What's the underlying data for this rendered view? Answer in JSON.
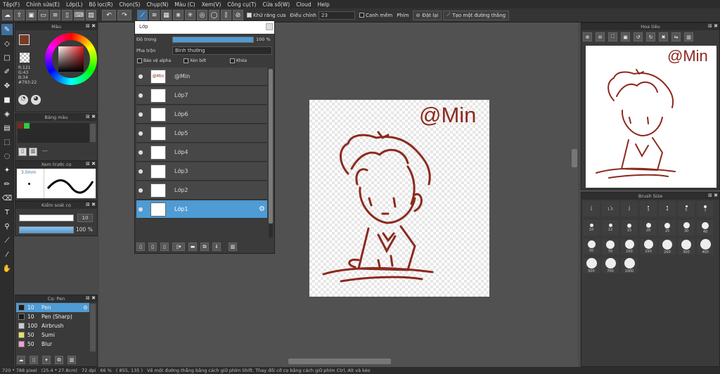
{
  "menu": [
    "Tệp(F)",
    "Chỉnh sửa(E)",
    "Lớp(L)",
    "Bộ lọc(R)",
    "Chọn(S)",
    "Chụp(N)",
    "Màu (C)",
    "Xem(V)",
    "Công cụ(T)",
    "Cửa sổ(W)",
    "Cloud",
    "Help"
  ],
  "toolbar": {
    "antialias_label": "Khử răng cưa",
    "adjust_label": "Điều chỉnh",
    "adjust_value": "23",
    "snap_label": "Canh mềm",
    "key_label": "Phím",
    "reset_label": "Đặt lại",
    "line_label": "Tạo một đường thẳng"
  },
  "color_panel": {
    "title": "Màu",
    "r": "R:121",
    "g": "G:43",
    "b": "B:34",
    "hex": "#793:22",
    "fg_color": "#793a22",
    "accent": "#3d6f9e"
  },
  "palette_panel": {
    "title": "Bảng màu",
    "label": "---"
  },
  "brush_preview": {
    "title": "Xem trước cọ",
    "size": "3.0mm"
  },
  "brush_control": {
    "title": "Kiểm soát cọ",
    "size_value": "10",
    "opacity_value": "100 %"
  },
  "brush_list": {
    "title": "Cọ: Pen",
    "items": [
      {
        "size": "10",
        "name": "Pen",
        "color": "#1a1a1a"
      },
      {
        "size": "10",
        "name": "Pen (Sharp)",
        "color": "#1a1a1a"
      },
      {
        "size": "100",
        "name": "Airbrush",
        "color": "#cccccc"
      },
      {
        "size": "50",
        "name": "Sumi",
        "color": "#e8e060"
      },
      {
        "size": "50",
        "name": "Blur",
        "color": "#f0a0d0"
      }
    ]
  },
  "layer_panel": {
    "title": "Lớp",
    "opacity_label": "Độ trong",
    "opacity_value": "100 %",
    "blend_label": "Pha trộn",
    "blend_value": "Bình thường",
    "protect_alpha": "Bảo vệ alpha",
    "clip": "Xén bớt",
    "lock": "Khóa",
    "layers": [
      {
        "name": "@Min",
        "thumb": "@Min"
      },
      {
        "name": "Lớp7",
        "thumb": ""
      },
      {
        "name": "Lớp6",
        "thumb": ""
      },
      {
        "name": "Lớp5",
        "thumb": ""
      },
      {
        "name": "Lớp4",
        "thumb": ""
      },
      {
        "name": "Lớp3",
        "thumb": ""
      },
      {
        "name": "Lớp2",
        "thumb": ""
      },
      {
        "name": "Lớp1",
        "thumb": ""
      }
    ],
    "selected": "Lớp1"
  },
  "canvas": {
    "watermark": "@Min",
    "ink": "#8b2a1e"
  },
  "navigator": {
    "title": "Hoa tiêu",
    "watermark": "@Min"
  },
  "brush_size": {
    "title": "Brush Size",
    "sizes": [
      "1",
      "1.5",
      "2",
      "3",
      "4",
      "5",
      "7",
      "10",
      "12",
      "15",
      "20",
      "25",
      "30",
      "40",
      "50",
      "70",
      "100",
      "150",
      "200",
      "300",
      "400",
      "500",
      "700",
      "1000"
    ]
  },
  "status": {
    "dims": "720 * 788 pixel",
    "cm": "(25.4 * 27.8cm)",
    "dpi": "72 dpi",
    "zoom": "66 %",
    "coords": "( 855, 135 )",
    "hint": "Vẽ một đường thẳng bằng cách giữ phím Shift. Thay đổi cỡ cọ bằng cách giữ phím Ctrl, Alt và kéo"
  }
}
